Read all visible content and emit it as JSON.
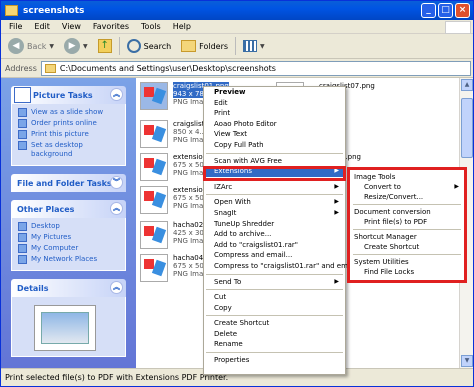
{
  "window": {
    "title": "screenshots"
  },
  "menubar": [
    "File",
    "Edit",
    "View",
    "Favorites",
    "Tools",
    "Help"
  ],
  "toolbar": {
    "back": "Back",
    "search": "Search",
    "folders": "Folders"
  },
  "address": {
    "label": "Address",
    "value": "C:\\Documents and Settings\\user\\Desktop\\screenshots"
  },
  "left_panel": {
    "picture_tasks": {
      "title": "Picture Tasks",
      "items": [
        "View as a slide show",
        "Order prints online",
        "Print this picture",
        "Set as desktop background"
      ]
    },
    "file_folder_tasks": {
      "title": "File and Folder Tasks"
    },
    "other_places": {
      "title": "Other Places",
      "items": [
        "Desktop",
        "My Pictures",
        "My Computer",
        "My Network Places"
      ]
    },
    "details": {
      "title": "Details"
    }
  },
  "files": [
    {
      "name": "craigslist01.png",
      "size": "943 x 786",
      "type": "PNG Image",
      "selected": true
    },
    {
      "name": "craigslist07.png",
      "size": "",
      "type": "",
      "selected": false
    },
    {
      "name": "craigslist...",
      "size": "850 x 4...",
      "type": "PNG Imag...",
      "selected": false
    },
    {
      "name": "extensions",
      "size": "675 x 500",
      "type": "PNG Image",
      "selected": false
    },
    {
      "name": "...png",
      "size": "",
      "type": "",
      "selected": false
    },
    {
      "name": "extensions",
      "size": "675 x 500",
      "type": "PNG Image",
      "selected": false
    },
    {
      "name": "hacha02.p",
      "size": "425 x 30",
      "type": "PNG Imag",
      "selected": false
    },
    {
      "name": "hacha04.p",
      "size": "675 x 50",
      "type": "PNG Image",
      "selected": false
    }
  ],
  "context_menu": {
    "items": [
      {
        "label": "Preview",
        "bold": true
      },
      {
        "label": "Edit"
      },
      {
        "label": "Print"
      },
      {
        "label": "Aoao Photo Editor"
      },
      {
        "label": "View Text"
      },
      {
        "label": "Copy Full Path"
      },
      {
        "sep": true
      },
      {
        "label": "Scan with AVG Free"
      },
      {
        "label": "Extensions",
        "highlight": true,
        "submenu": true
      },
      {
        "sep": true
      },
      {
        "label": "IZArc",
        "submenu": true
      },
      {
        "sep": true
      },
      {
        "label": "Open With",
        "submenu": true
      },
      {
        "label": "SnagIt",
        "submenu": true
      },
      {
        "label": "TuneUp Shredder"
      },
      {
        "label": "Add to archive..."
      },
      {
        "label": "Add to \"craigslist01.rar\""
      },
      {
        "label": "Compress and email..."
      },
      {
        "label": "Compress to \"craigslist01.rar\" and email"
      },
      {
        "sep": true
      },
      {
        "label": "Send To",
        "submenu": true
      },
      {
        "sep": true
      },
      {
        "label": "Cut"
      },
      {
        "label": "Copy"
      },
      {
        "sep": true
      },
      {
        "label": "Create Shortcut"
      },
      {
        "label": "Delete"
      },
      {
        "label": "Rename"
      },
      {
        "sep": true
      },
      {
        "label": "Properties"
      }
    ]
  },
  "submenu": {
    "items": [
      {
        "label": "Image Tools",
        "indent": 4
      },
      {
        "label": "Convert to",
        "indent": 14,
        "submenu": true
      },
      {
        "label": "Resize/Convert...",
        "indent": 14
      },
      {
        "sep": true
      },
      {
        "label": "Document conversion",
        "indent": 4
      },
      {
        "label": "Print file(s) to PDF",
        "indent": 14
      },
      {
        "sep": true
      },
      {
        "label": "Shortcut Manager",
        "indent": 4
      },
      {
        "label": "Create Shortcut",
        "indent": 14
      },
      {
        "sep": true
      },
      {
        "label": "System Utilities",
        "indent": 4
      },
      {
        "label": "Find File Locks",
        "indent": 14
      }
    ]
  },
  "status": {
    "text": "Print selected file(s) to PDF with Extensions PDF Printer."
  },
  "colors": {
    "accent": "#316ac5",
    "highlight_box": "#e02020",
    "taskpane": "#6375d6"
  }
}
